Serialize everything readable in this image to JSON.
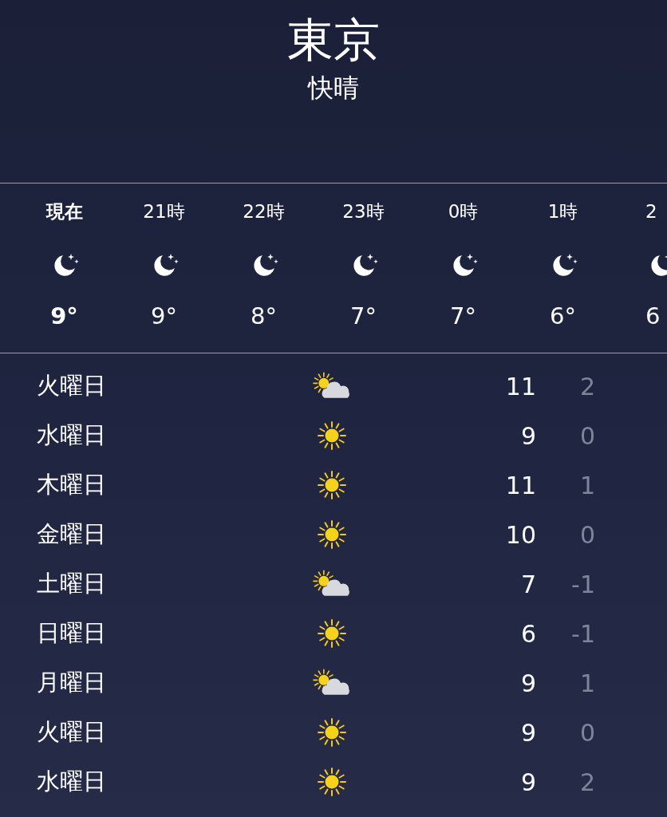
{
  "location": {
    "city": "東京",
    "condition": "快晴"
  },
  "hourly": [
    {
      "time": "現在",
      "kind": "moon",
      "temp": "9°",
      "current": true
    },
    {
      "time": "21時",
      "kind": "moon",
      "temp": "9°",
      "current": false
    },
    {
      "time": "22時",
      "kind": "moon",
      "temp": "8°",
      "current": false
    },
    {
      "time": "23時",
      "kind": "moon",
      "temp": "7°",
      "current": false
    },
    {
      "time": "0時",
      "kind": "moon",
      "temp": "7°",
      "current": false
    },
    {
      "time": "1時",
      "kind": "moon",
      "temp": "6°",
      "current": false
    },
    {
      "time": "2",
      "kind": "moon",
      "temp": "6",
      "current": false
    }
  ],
  "daily": [
    {
      "day": "火曜日",
      "kind": "partly-cloudy",
      "high": "11",
      "low": "2"
    },
    {
      "day": "水曜日",
      "kind": "sun",
      "high": "9",
      "low": "0"
    },
    {
      "day": "木曜日",
      "kind": "sun",
      "high": "11",
      "low": "1"
    },
    {
      "day": "金曜日",
      "kind": "sun",
      "high": "10",
      "low": "0"
    },
    {
      "day": "土曜日",
      "kind": "partly-cloudy",
      "high": "7",
      "low": "-1"
    },
    {
      "day": "日曜日",
      "kind": "sun",
      "high": "6",
      "low": "-1"
    },
    {
      "day": "月曜日",
      "kind": "partly-cloudy",
      "high": "9",
      "low": "1"
    },
    {
      "day": "火曜日",
      "kind": "sun",
      "high": "9",
      "low": "0"
    },
    {
      "day": "水曜日",
      "kind": "sun",
      "high": "9",
      "low": "2"
    }
  ]
}
